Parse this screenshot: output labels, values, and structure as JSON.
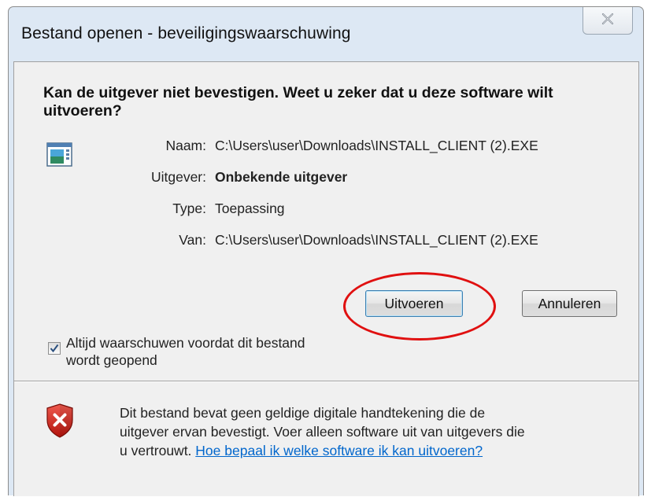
{
  "window": {
    "title": "Bestand openen - beveiligingswaarschuwing",
    "close_glyph": "☒"
  },
  "dialog": {
    "heading": "Kan de uitgever niet bevestigen. Weet u zeker dat u deze software wilt uitvoeren?",
    "app_icon": "application-window-icon",
    "fields": {
      "name_label": "Naam:",
      "name_value": "C:\\Users\\user\\Downloads\\INSTALL_CLIENT (2).EXE",
      "publisher_label": "Uitgever:",
      "publisher_value": "Onbekende uitgever",
      "type_label": "Type:",
      "type_value": "Toepassing",
      "from_label": "Van:",
      "from_value": "C:\\Users\\user\\Downloads\\INSTALL_CLIENT (2).EXE"
    },
    "buttons": {
      "run": "Uitvoeren",
      "cancel": "Annuleren"
    },
    "checkbox": {
      "checked": true,
      "label_line1": "Altijd waarschuwen voordat dit bestand",
      "label_line2": "wordt geopend"
    },
    "warning": {
      "icon": "shield-x-icon",
      "line1": "Dit bestand bevat geen geldige digitale handtekening die de",
      "line2": "uitgever ervan bevestigt. Voer alleen software uit van uitgevers die",
      "line3_prefix": "u vertrouwt. ",
      "link": "Hoe bepaal ik welke software ik kan uitvoeren?"
    }
  },
  "annotation": {
    "color": "#e01010",
    "target": "run-button"
  },
  "colors": {
    "frame": "#dde8f4",
    "client": "#f0f0f0",
    "link": "#0066cc"
  }
}
